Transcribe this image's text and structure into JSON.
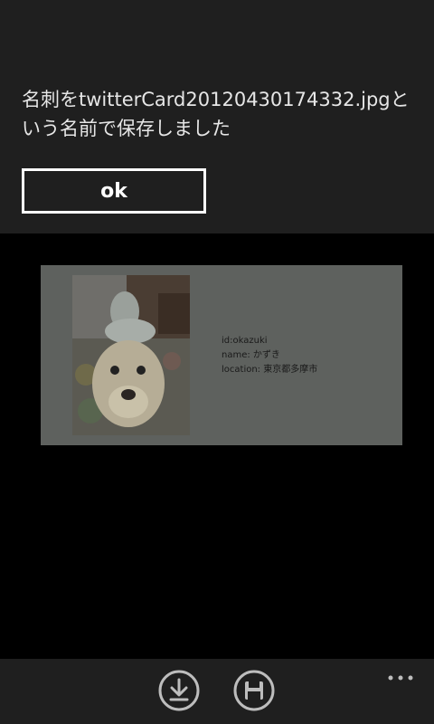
{
  "dialog": {
    "message": "名刺をtwitterCard20120430174332.jpgという名前で保存しました",
    "ok_label": "ok"
  },
  "card": {
    "id_line": "id:okazuki",
    "name_line": "name: かずき",
    "location_line": "location: 東京都多摩市"
  },
  "appbar": {
    "icons": [
      "download-icon",
      "save-icon",
      "more-icon"
    ]
  }
}
